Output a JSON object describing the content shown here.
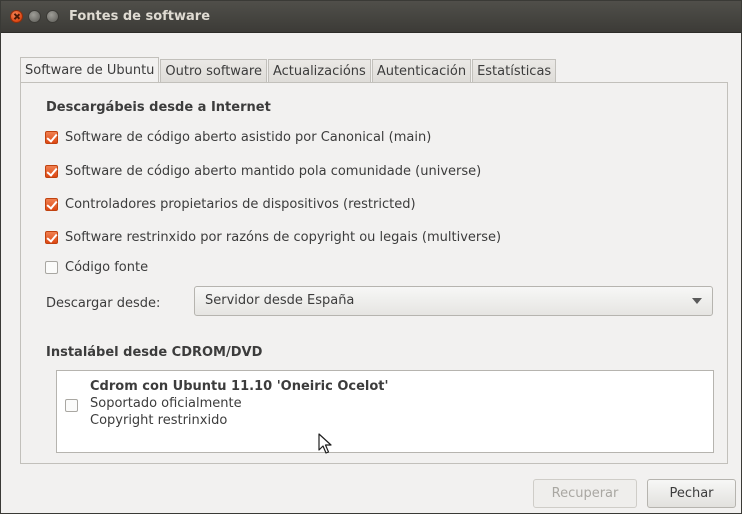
{
  "window": {
    "title": "Fontes de software"
  },
  "tabs": [
    {
      "label": "Software de Ubuntu",
      "active": true
    },
    {
      "label": "Outro software",
      "active": false
    },
    {
      "label": "Actualizacións",
      "active": false
    },
    {
      "label": "Autenticación",
      "active": false
    },
    {
      "label": "Estatísticas",
      "active": false
    }
  ],
  "internet_section": {
    "heading": "Descargábeis desde a Internet",
    "options": [
      {
        "label": "Software de código aberto asistido por Canonical (main)",
        "checked": true
      },
      {
        "label": "Software de código aberto mantido pola comunidade (universe)",
        "checked": true
      },
      {
        "label": "Controladores propietarios de dispositivos (restricted)",
        "checked": true
      },
      {
        "label": "Software restrinxido por razóns de copyright ou legais (multiverse)",
        "checked": true
      },
      {
        "label": "Código fonte",
        "checked": false
      }
    ],
    "download_from_label": "Descargar desde:",
    "download_from_value": "Servidor desde España"
  },
  "cdrom_section": {
    "heading": "Instalábel desde CDROM/DVD",
    "entry": {
      "title": "Cdrom con Ubuntu 11.10 'Oneiric Ocelot'",
      "line1": "Soportado oficialmente",
      "line2": "Copyright restrinxido",
      "checked": false
    }
  },
  "buttons": {
    "revert_label": "Recuperar",
    "close_label": "Pechar"
  },
  "colors": {
    "accent": "#dd4814",
    "titlebar": "#3c3b37",
    "background": "#f2f1f0"
  }
}
